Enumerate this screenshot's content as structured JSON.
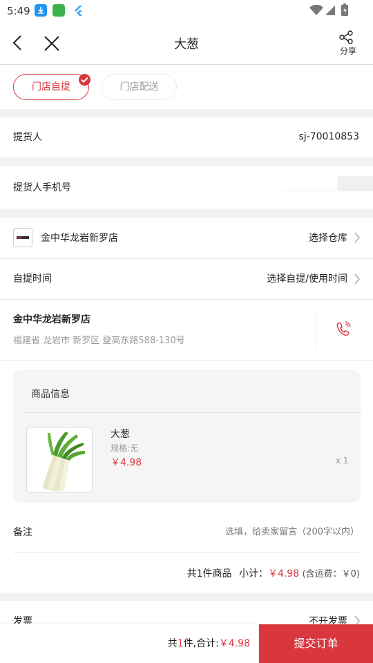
{
  "status_bar": {
    "time": "5:49"
  },
  "header": {
    "title": "大葱",
    "share_label": "分享"
  },
  "tabs": [
    {
      "label": "门店自提",
      "active": true
    },
    {
      "label": "门店配送",
      "active": false
    }
  ],
  "pickup": {
    "person_label": "提货人",
    "person_value": "sj-70010853",
    "phone_label": "提货人手机号"
  },
  "store": {
    "name": "金中华龙岩新罗店",
    "select_warehouse": "选择仓库",
    "pickup_time_label": "自提时间",
    "pickup_time_action": "选择自提/使用时间",
    "detail_name": "金中华龙岩新罗店",
    "address": "福建省 龙岩市 新罗区 登高东路588-130号"
  },
  "goods": {
    "section_title": "商品信息",
    "name": "大葱",
    "spec": "规格:无",
    "price": "￥4.98",
    "qty": "x 1"
  },
  "remark": {
    "label": "备注",
    "placeholder": "选填，给卖家留言（200字以内）"
  },
  "summary": {
    "count_text": "共1件商品",
    "subtotal_label": "小计：",
    "subtotal_value": "￥4.98",
    "shipping_text": "(含运费：￥0)"
  },
  "invoice": {
    "label": "发票",
    "value": "不开发票"
  },
  "footer": {
    "prefix": "共",
    "count": "1",
    "suffix": "件,合计:",
    "total": "￥4.98",
    "submit_label": "提交订单"
  },
  "colors": {
    "accent": "#d9363e",
    "background_gap": "#f2f2f2"
  }
}
